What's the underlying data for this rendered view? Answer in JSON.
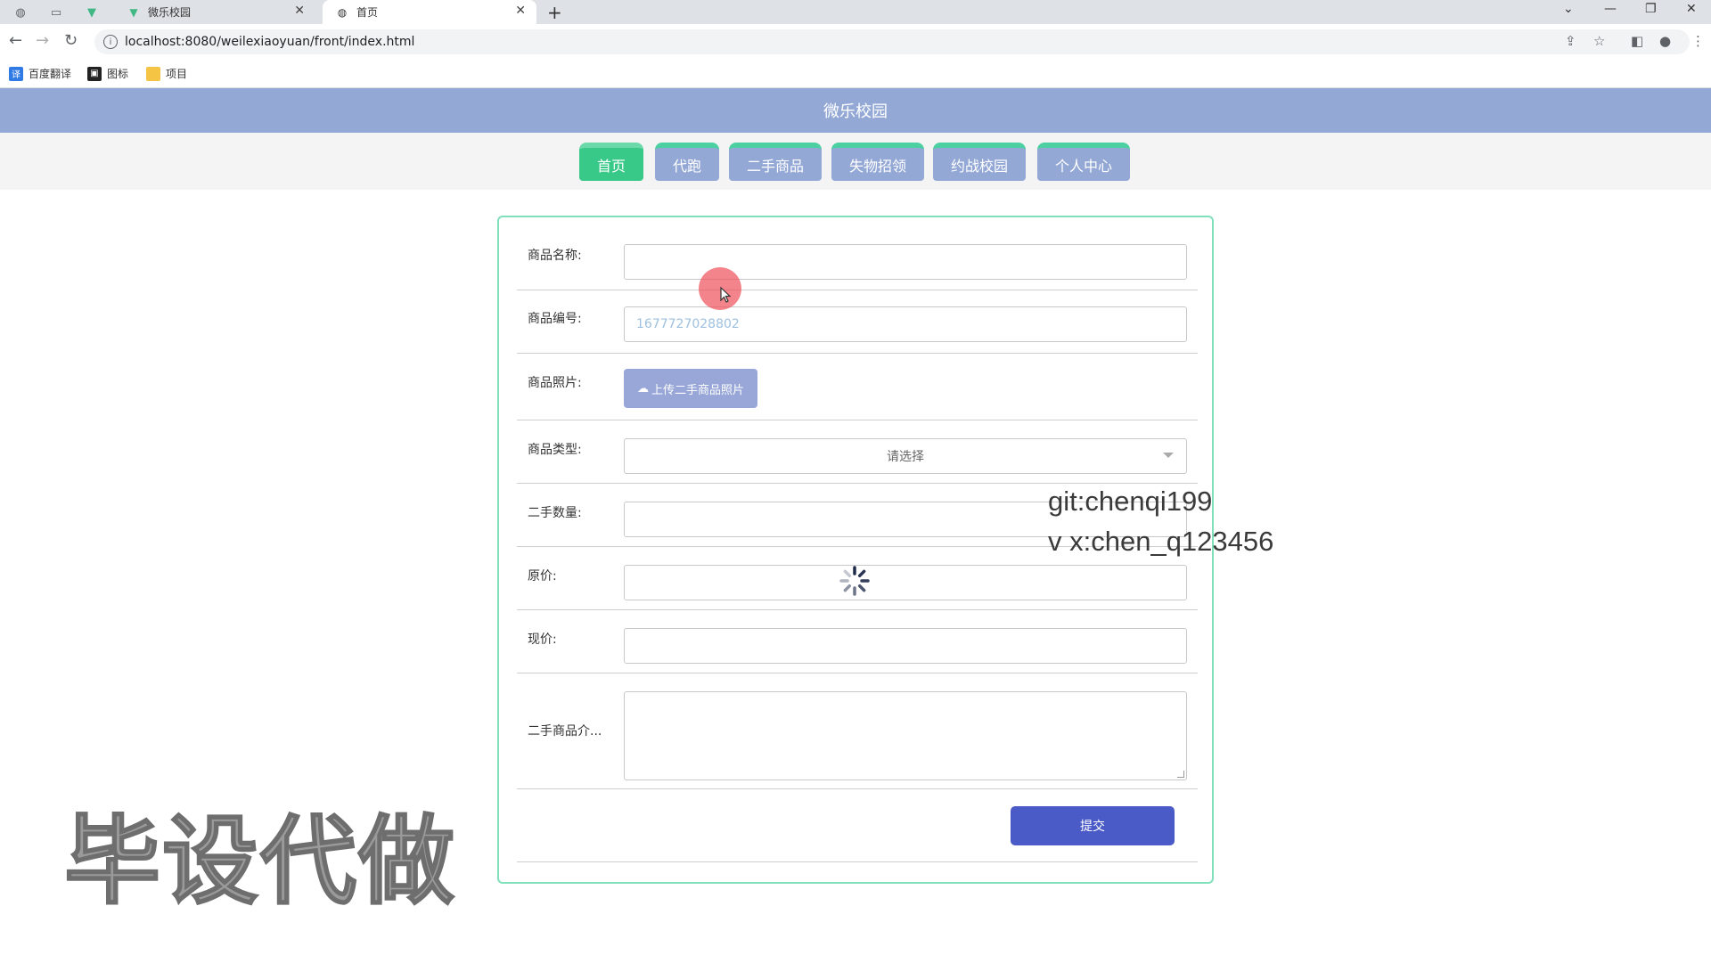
{
  "browser": {
    "tabs": [
      {
        "title": "微乐校园",
        "active": false,
        "favicon": "vue-logo-icon"
      },
      {
        "title": "首页",
        "active": true,
        "favicon": "globe-icon"
      }
    ],
    "url": "localhost:8080/weilexiaoyuan/front/index.html",
    "bookmarks": [
      {
        "label": "百度翻译",
        "icon": "translate-icon"
      },
      {
        "label": "图标",
        "icon": "bookmark-icon"
      },
      {
        "label": "项目",
        "icon": "folder-icon"
      }
    ]
  },
  "site": {
    "title": "微乐校园",
    "nav": [
      {
        "label": "首页",
        "active": true
      },
      {
        "label": "代跑",
        "active": false
      },
      {
        "label": "二手商品",
        "active": false
      },
      {
        "label": "失物招领",
        "active": false
      },
      {
        "label": "约战校园",
        "active": false
      },
      {
        "label": "个人中心",
        "active": false
      }
    ]
  },
  "form": {
    "name_label": "商品名称:",
    "name_value": "",
    "code_label": "商品编号:",
    "code_value": "1677727028802",
    "photo_label": "商品照片:",
    "upload_label": "上传二手商品照片",
    "type_label": "商品类型:",
    "type_placeholder": "请选择",
    "qty_label": "二手数量:",
    "orig_price_label": "原价:",
    "cur_price_label": "现价:",
    "desc_label": "二手商品介...",
    "submit_label": "提交"
  },
  "watermarks": {
    "git": "git:chenqi199",
    "wx": "v x:chen_q123456",
    "big": "毕设代做"
  },
  "colors": {
    "header": "#94a8d6",
    "nav_active": "#38c989",
    "card_border": "#7fe0bb",
    "submit": "#4a5bc7"
  }
}
